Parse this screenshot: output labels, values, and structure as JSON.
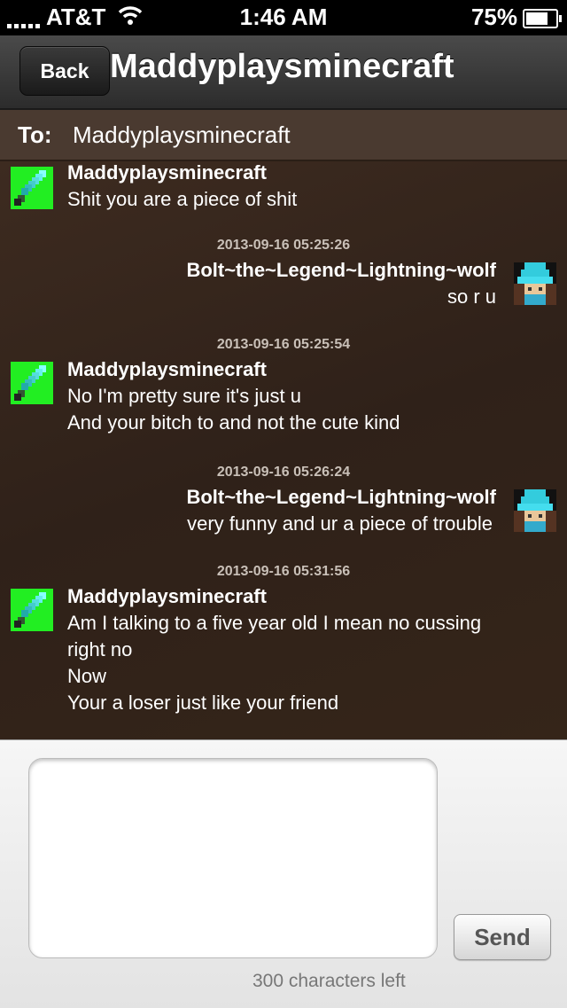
{
  "status_bar": {
    "carrier": "AT&T",
    "time": "1:46 AM",
    "battery": "75%",
    "battery_level": 0.75,
    "icons": [
      "signal-icon",
      "wifi-icon",
      "battery-icon"
    ]
  },
  "nav": {
    "back_label": "Back",
    "title": "Maddyplaysminecraft"
  },
  "to_row": {
    "label": "To:",
    "value": "Maddyplaysminecraft"
  },
  "messages": [
    {
      "sender": "Maddyplaysminecraft",
      "direction": "incoming",
      "lines": [
        "Shit you are a piece of shit"
      ]
    },
    {
      "timestamp": "2013-09-16 05:25:26",
      "sender": "Bolt~the~Legend~Lightning~wolf",
      "direction": "outgoing",
      "lines": [
        "so r u"
      ]
    },
    {
      "timestamp": "2013-09-16 05:25:54",
      "sender": "Maddyplaysminecraft",
      "direction": "incoming",
      "lines": [
        "No I'm pretty sure it's just u",
        "And your bitch to and not the cute kind"
      ]
    },
    {
      "timestamp": "2013-09-16 05:26:24",
      "sender": "Bolt~the~Legend~Lightning~wolf",
      "direction": "outgoing",
      "lines": [
        "very funny and ur a piece of trouble"
      ]
    },
    {
      "timestamp": "2013-09-16 05:31:56",
      "sender": "Maddyplaysminecraft",
      "direction": "incoming",
      "lines": [
        "Am I talking to a five year old I mean no cussing",
        "right no",
        "Now",
        "Your a loser just like your friend"
      ]
    }
  ],
  "compose": {
    "input_value": "",
    "send_label": "Send",
    "char_count": "300 characters left"
  },
  "colors": {
    "chat_background": "#35251b",
    "nav_background": "#3a3a3a",
    "incoming_avatar": "#22ee22",
    "outgoing_avatar": "#33ccdd"
  }
}
